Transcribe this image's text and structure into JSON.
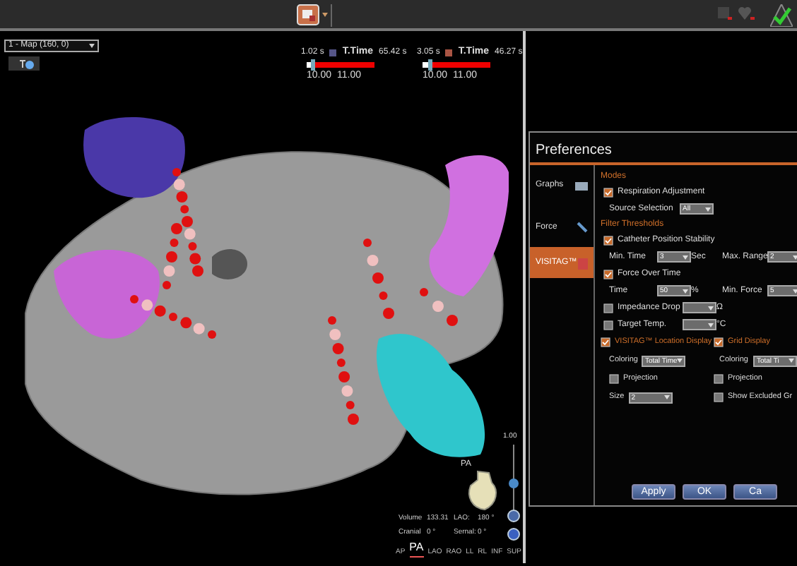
{
  "map_selector": {
    "value": "1 - Map (160, 0)"
  },
  "legends": [
    {
      "min": "1.02 s",
      "label": "T.Time",
      "max": "65.42 s",
      "low": "10.00",
      "high": "11.00",
      "level": 0.08
    },
    {
      "min": "3.05 s",
      "label": "T.Time",
      "max": "46.27 s",
      "low": "10.00",
      "high": "11.00",
      "level": 0.1
    }
  ],
  "preferences": {
    "title": "Preferences",
    "tabs": [
      {
        "label": "Graphs",
        "selected": false
      },
      {
        "label": "Force",
        "selected": false
      },
      {
        "label": "VISITAG™",
        "selected": true
      }
    ],
    "rows": [
      {
        "kind": "heading",
        "text": "Modes"
      },
      {
        "kind": "checkbox",
        "label": "Respiration Adjustment",
        "checked": true
      },
      {
        "kind": "fields",
        "items": [
          {
            "kind": "label",
            "text": "Source Selection"
          },
          {
            "kind": "select",
            "value": "All"
          }
        ]
      },
      {
        "kind": "heading",
        "text": "Filter Thresholds"
      },
      {
        "kind": "checkbox",
        "label": "Catheter Position Stability",
        "checked": true
      },
      {
        "kind": "fields",
        "items": [
          {
            "kind": "label",
            "text": "Min. Time"
          },
          {
            "kind": "select",
            "value": "3"
          },
          {
            "kind": "label",
            "text": "Sec"
          },
          {
            "kind": "label",
            "text": "Max. Range"
          },
          {
            "kind": "select",
            "value": "2"
          }
        ]
      },
      {
        "kind": "checkbox",
        "label": "Force Over Time",
        "checked": true
      },
      {
        "kind": "fields",
        "items": [
          {
            "kind": "label",
            "text": "Time"
          },
          {
            "kind": "select",
            "value": "50"
          },
          {
            "kind": "label",
            "text": "%"
          },
          {
            "kind": "label",
            "text": "Min. Force"
          },
          {
            "kind": "select",
            "value": "5"
          }
        ]
      },
      {
        "kind": "fields",
        "items": [
          {
            "kind": "checkbox",
            "label": "Impedance Drop",
            "checked": false
          },
          {
            "kind": "select",
            "value": ""
          },
          {
            "kind": "label",
            "text": "Ω"
          }
        ]
      },
      {
        "kind": "fields",
        "items": [
          {
            "kind": "checkbox",
            "label": "Target Temp.",
            "checked": false
          },
          {
            "kind": "select",
            "value": ""
          },
          {
            "kind": "label",
            "text": "°C"
          }
        ]
      },
      {
        "kind": "pair",
        "left": [
          {
            "kind": "heading-check",
            "label": "VISITAG™ Location Display",
            "checked": true
          }
        ],
        "right": [
          {
            "kind": "heading-check",
            "label": "Grid Display",
            "checked": true
          }
        ]
      },
      {
        "kind": "pair",
        "left": [
          {
            "kind": "label",
            "text": "Coloring"
          },
          {
            "kind": "select",
            "value": "Total Time"
          }
        ],
        "right": [
          {
            "kind": "label",
            "text": "Coloring"
          },
          {
            "kind": "select",
            "value": "Total Ti"
          }
        ]
      },
      {
        "kind": "pair",
        "left": [
          {
            "kind": "checkbox",
            "label": "Projection",
            "checked": false
          }
        ],
        "right": [
          {
            "kind": "checkbox",
            "label": "Projection",
            "checked": false
          }
        ]
      },
      {
        "kind": "pair",
        "left": [
          {
            "kind": "label",
            "text": "Size"
          },
          {
            "kind": "select",
            "value": "2"
          }
        ],
        "right": [
          {
            "kind": "checkbox",
            "label": "Show Excluded Gr",
            "checked": false
          }
        ]
      }
    ],
    "buttons": [
      "Apply",
      "OK",
      "Ca"
    ]
  },
  "zoom_slider": {
    "label": "1.00",
    "level": 0.5
  },
  "orientation_label": "PA",
  "readouts": [
    {
      "label": "Volume",
      "value": "133.31"
    },
    {
      "label": "LAO:",
      "value": "180 °"
    },
    {
      "label": "Cranial",
      "value": "0 °"
    },
    {
      "label": "Sernal:",
      "value": "0 °"
    }
  ],
  "views": [
    {
      "label": "AP",
      "selected": false
    },
    {
      "label": "PA",
      "selected": true
    },
    {
      "label": "LAO",
      "selected": false
    },
    {
      "label": "RAO",
      "selected": false
    },
    {
      "label": "LL",
      "selected": false
    },
    {
      "label": "RL",
      "selected": false
    },
    {
      "label": "INF",
      "selected": false
    },
    {
      "label": "SUP",
      "selected": false
    }
  ]
}
